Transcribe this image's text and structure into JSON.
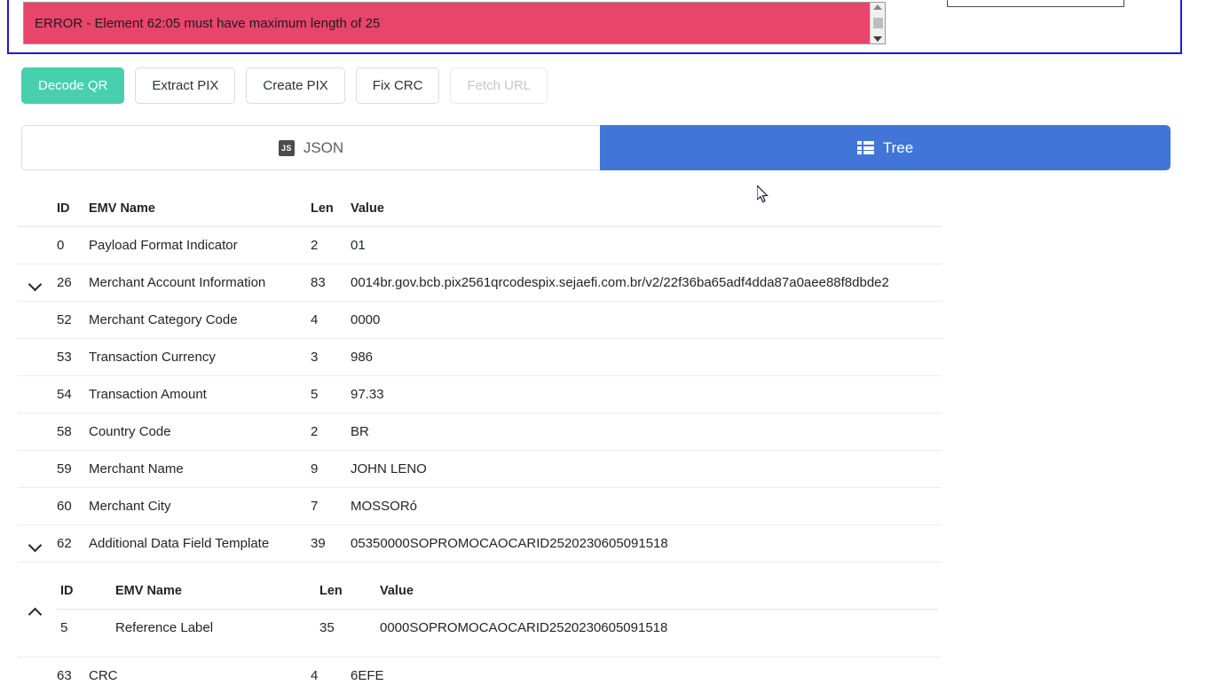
{
  "alert": {
    "message": "ERROR - Element 62:05 must have maximum length of 25",
    "scroll_up_icon": "scroll-up-arrow-icon",
    "scroll_down_icon": "scroll-down-arrow-icon"
  },
  "qr_preview": {
    "name": "qr-code-preview-box"
  },
  "toolbar": {
    "buttons": [
      {
        "label": "Decode QR",
        "state": "primary"
      },
      {
        "label": "Extract PIX",
        "state": "default"
      },
      {
        "label": "Create PIX",
        "state": "default"
      },
      {
        "label": "Fix CRC",
        "state": "default"
      },
      {
        "label": "Fetch URL",
        "state": "disabled"
      }
    ]
  },
  "tabs": {
    "json": {
      "label": "JSON",
      "icon": "js-badge-icon",
      "icon_text": "JS",
      "active": false
    },
    "tree": {
      "label": "Tree",
      "icon": "list-view-icon",
      "active": true
    }
  },
  "table": {
    "headers": {
      "id": "ID",
      "name": "EMV Name",
      "len": "Len",
      "value": "Value"
    },
    "rows": [
      {
        "caret": "",
        "id": "0",
        "name": "Payload Format Indicator",
        "len": "2",
        "value": "01"
      },
      {
        "caret": "down",
        "id": "26",
        "name": "Merchant Account Information",
        "len": "83",
        "value": "0014br.gov.bcb.pix2561qrcodespix.sejaefi.com.br/v2/22f36ba65adf4dda87a0aee88f8dbde2"
      },
      {
        "caret": "",
        "id": "52",
        "name": "Merchant Category Code",
        "len": "4",
        "value": "0000"
      },
      {
        "caret": "",
        "id": "53",
        "name": "Transaction Currency",
        "len": "3",
        "value": "986"
      },
      {
        "caret": "",
        "id": "54",
        "name": "Transaction Amount",
        "len": "5",
        "value": "97.33"
      },
      {
        "caret": "",
        "id": "58",
        "name": "Country Code",
        "len": "2",
        "value": "BR"
      },
      {
        "caret": "",
        "id": "59",
        "name": "Merchant Name",
        "len": "9",
        "value": "JOHN LENO"
      },
      {
        "caret": "",
        "id": "60",
        "name": "Merchant City",
        "len": "7",
        "value": "MOSSORó"
      },
      {
        "caret": "down",
        "id": "62",
        "name": "Additional Data Field Template",
        "len": "39",
        "value": "05350000SOPROMOCAOCARID2520230605091518"
      }
    ],
    "nested": {
      "caret": "up",
      "headers": {
        "id": "ID",
        "name": "EMV Name",
        "len": "Len",
        "value": "Value"
      },
      "rows": [
        {
          "id": "5",
          "name": "Reference Label",
          "len": "35",
          "value": "0000SOPROMOCAOCARID2520230605091518"
        }
      ]
    },
    "last_row": {
      "caret": "",
      "id": "63",
      "name": "CRC",
      "len": "4",
      "value": "6EFE"
    }
  },
  "colors": {
    "alert_bg": "#e8456b",
    "primary_button": "#48cfad",
    "active_tab": "#4176d8",
    "frame_border": "#2019d8"
  }
}
